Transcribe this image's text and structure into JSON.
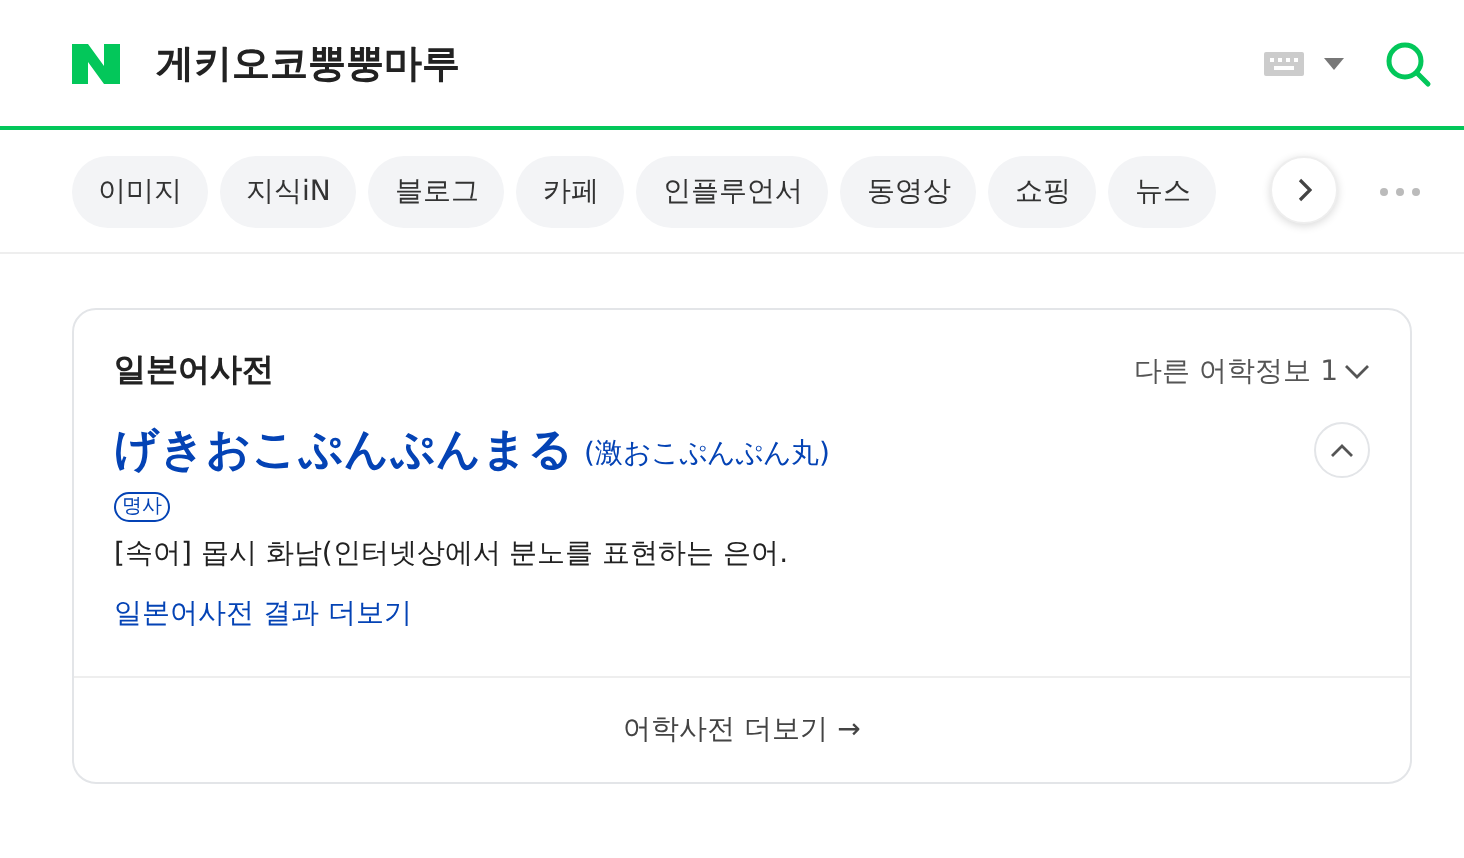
{
  "header": {
    "query": "게키오코뿡뿡마루"
  },
  "tabs": [
    {
      "label": "이미지"
    },
    {
      "label": "지식iN"
    },
    {
      "label": "블로그"
    },
    {
      "label": "카페"
    },
    {
      "label": "인플루언서"
    },
    {
      "label": "동영상"
    },
    {
      "label": "쇼핑"
    },
    {
      "label": "뉴스"
    }
  ],
  "card": {
    "title": "일본어사전",
    "other_info": "다른 어학정보 1",
    "word": "げきおこぷんぷんまる",
    "kanji": "(激おこぷんぷん丸)",
    "pos": "명사",
    "definition": "[속어] 몹시 화남(인터넷상에서 분노를 표현하는 은어.",
    "more_link": "일본어사전 결과 더보기",
    "footer_link": "어학사전 더보기 →"
  }
}
